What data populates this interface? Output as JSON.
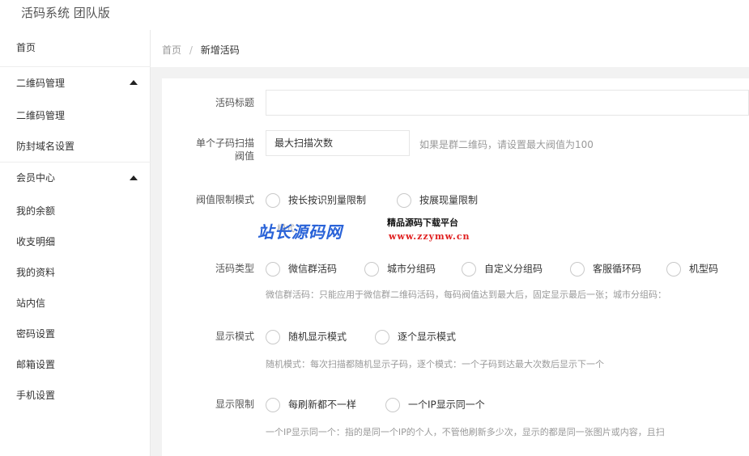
{
  "header": {
    "app_title": "活码系统 团队版"
  },
  "sidebar": {
    "items": [
      {
        "label": "首页"
      },
      {
        "label": "二维码管理"
      },
      {
        "label": "二维码管理"
      },
      {
        "label": "防封域名设置"
      },
      {
        "label": "会员中心"
      },
      {
        "label": "我的余额"
      },
      {
        "label": "收支明细"
      },
      {
        "label": "我的资料"
      },
      {
        "label": "站内信"
      },
      {
        "label": "密码设置"
      },
      {
        "label": "邮箱设置"
      },
      {
        "label": "手机设置"
      }
    ]
  },
  "breadcrumb": {
    "home": "首页",
    "separator": "/",
    "current": "新增活码"
  },
  "form": {
    "title_label": "活码标题",
    "title_value": "",
    "scan_label_line1": "单个子码扫描",
    "scan_label_line2": "阀值",
    "scan_placeholder": "最大扫描次数",
    "scan_hint": "如果是群二维码，请设置最大阀值为100",
    "limit_label": "阀值限制模式",
    "limit_options": [
      "按长按识别量限制",
      "按展现量限制"
    ],
    "type_label": "活码类型",
    "type_options": [
      "微信群活码",
      "城市分组码",
      "自定义分组码",
      "客服循环码",
      "机型码"
    ],
    "type_help": "微信群活码：只能应用于微信群二维码活码，每码阀值达到最大后，固定显示最后一张；城市分组码：",
    "display_label": "显示模式",
    "display_options": [
      "随机显示模式",
      "逐个显示模式"
    ],
    "display_help": "随机模式：每次扫描都随机显示子码，逐个模式：一个子码到达最大次数后显示下一个",
    "restrict_label": "显示限制",
    "restrict_options": [
      "每刷新都不一样",
      "一个IP显示同一个"
    ],
    "restrict_help": "一个IP显示同一个：指的是同一个IP的个人，不管他刷新多少次，显示的都是同一张图片或内容，且扫"
  },
  "watermark": {
    "logo": "站长源码网",
    "slogan": "精品源码下载平台",
    "url": "www.zzymw.cn",
    "faint": "模式"
  }
}
